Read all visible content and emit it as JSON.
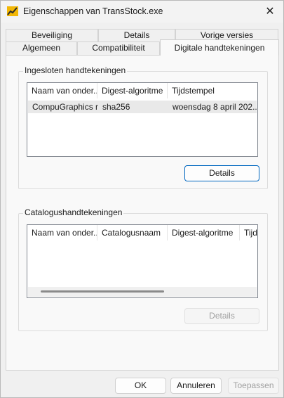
{
  "window": {
    "title": "Eigenschappen van TransStock.exe",
    "close_label": "✕"
  },
  "tabs": {
    "row1": [
      "Beveiliging",
      "Details",
      "Vorige versies"
    ],
    "row2": [
      "Algemeen",
      "Compatibiliteit",
      "Digitale handtekeningen"
    ],
    "active": "Digitale handtekeningen"
  },
  "embedded": {
    "label": "Ingesloten handtekeningen",
    "columns": [
      "Naam van onder...",
      "Digest-algoritme",
      "Tijdstempel"
    ],
    "rows": [
      [
        "CompuGraphics nv",
        "sha256",
        "woensdag 8 april 202..."
      ]
    ],
    "details_button": "Details"
  },
  "catalog": {
    "label": "Catalogushandtekeningen",
    "columns": [
      "Naam van onder...",
      "Catalogusnaam",
      "Digest-algoritme",
      "Tijds"
    ],
    "details_button": "Details"
  },
  "footer": {
    "ok": "OK",
    "cancel": "Annuleren",
    "apply": "Toepassen"
  },
  "colors": {
    "accent": "#0067c0",
    "icon_yellow": "#f2b705",
    "icon_dark": "#2b2b2b"
  }
}
